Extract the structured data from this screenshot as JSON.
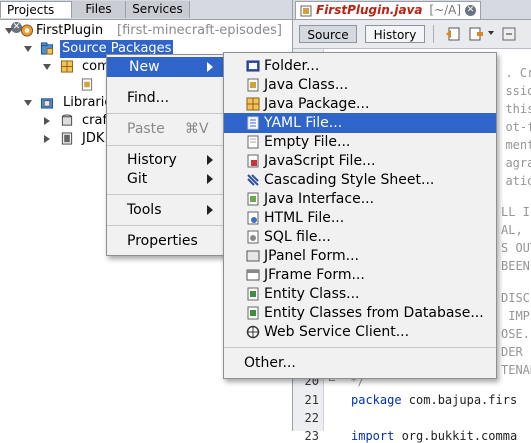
{
  "projects_panel": {
    "tabs": [
      {
        "label": "Projects"
      },
      {
        "label": "Files"
      },
      {
        "label": "Services"
      }
    ],
    "tree": {
      "project": "FirstPlugin",
      "project_suffix": "[first-minecraft-episodes]",
      "source_packages": "Source Packages",
      "package": "com",
      "libraries": "Librarie",
      "lib1": "craf",
      "jdk": "JDK"
    }
  },
  "editor": {
    "tab_title": "FirstPlugin.java",
    "tab_path": "[~/A]",
    "source_button": "Source",
    "history_button": "History",
    "code_fragments": [
      {
        "line": "",
        "text": "  . Cre"
      },
      {
        "line": "",
        "text": "  ssion"
      },
      {
        "line": "",
        "text": "  this"
      },
      {
        "line": "",
        "text": "  ot-fo"
      },
      {
        "line": "",
        "text": "  ment,"
      },
      {
        "line": "",
        "text": "  agrap"
      },
      {
        "line": "",
        "text": "  ation"
      },
      {
        "line": "",
        "text": "LL I"
      },
      {
        "line": "",
        "text": "AL, I"
      },
      {
        "line": "",
        "text": "S OUT"
      },
      {
        "line": "",
        "text": "BEEN"
      },
      {
        "line": "",
        "text": "DISCL"
      },
      {
        "line": "",
        "text": " IMPL"
      },
      {
        "line": "",
        "text": "OSE."
      },
      {
        "line": "",
        "text": "DER I"
      },
      {
        "line": "",
        "text": "TENAN"
      }
    ],
    "line20": "20",
    "line20_text": " */",
    "line21": "21",
    "line21_kw": "package",
    "line21_text": " com.bajupa.firs",
    "line22": "22",
    "line23": "23",
    "line23_kw": "import",
    "line23_text": " org.bukkit.comma"
  },
  "context_menu": {
    "items": [
      {
        "label": "New",
        "submenu": true
      },
      {
        "label": "Find..."
      },
      {
        "label": "Paste",
        "shortcut": "⌘V",
        "disabled": true
      },
      {
        "label": "History",
        "submenu": true
      },
      {
        "label": "Git",
        "submenu": true
      },
      {
        "label": "Tools",
        "submenu": true
      },
      {
        "label": "Properties"
      }
    ]
  },
  "new_submenu": {
    "items": [
      {
        "label": "Folder...",
        "icon": "folder-icon"
      },
      {
        "label": "Java Class...",
        "icon": "java-class-icon"
      },
      {
        "label": "Java Package...",
        "icon": "package-icon"
      },
      {
        "label": "YAML File...",
        "icon": "yaml-file-icon"
      },
      {
        "label": "Empty File...",
        "icon": "empty-file-icon"
      },
      {
        "label": "JavaScript File...",
        "icon": "javascript-file-icon"
      },
      {
        "label": "Cascading Style Sheet...",
        "icon": "css-file-icon"
      },
      {
        "label": "Java Interface...",
        "icon": "java-interface-icon"
      },
      {
        "label": "HTML File...",
        "icon": "html-file-icon"
      },
      {
        "label": "SQL file...",
        "icon": "sql-file-icon"
      },
      {
        "label": "JPanel Form...",
        "icon": "jpanel-form-icon"
      },
      {
        "label": "JFrame Form...",
        "icon": "jframe-form-icon"
      },
      {
        "label": "Entity Class...",
        "icon": "entity-class-icon"
      },
      {
        "label": "Entity Classes from Database...",
        "icon": "entity-db-icon"
      },
      {
        "label": "Web Service Client...",
        "icon": "web-service-icon"
      },
      {
        "label": "Other...",
        "icon": ""
      }
    ]
  },
  "colors": {
    "selection": "#2f65ca",
    "menu_bg": "#f1f1f1"
  }
}
